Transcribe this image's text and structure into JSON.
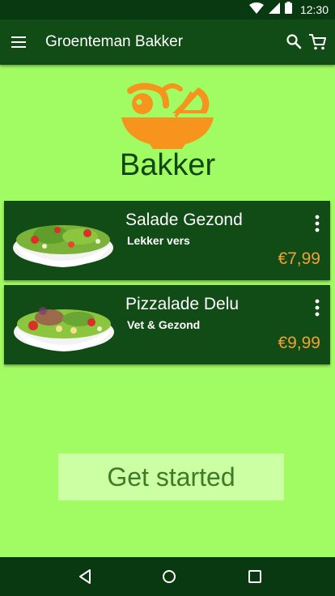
{
  "status_bar": {
    "time": "12:30"
  },
  "toolbar": {
    "title": "Groenteman Bakker"
  },
  "hero": {
    "title": "Bakker"
  },
  "products": [
    {
      "name": "Salade Gezond",
      "subtitle": "Lekker vers",
      "price": "€7,99"
    },
    {
      "name": "Pizzalade Delu",
      "subtitle": "Vet & Gezond",
      "price": "€9,99"
    }
  ],
  "cta": {
    "label": "Get started"
  },
  "colors": {
    "background": "#a1fb62",
    "toolbar": "#114b16",
    "status_bar": "#093910",
    "card": "#114b16",
    "price": "#f2a133",
    "logo": "#f7941d",
    "brand_text": "#124613",
    "cta_background": "#ccfea4",
    "cta_text": "#3f7a26"
  },
  "icons": {
    "status": [
      "wifi-icon",
      "signal-icon",
      "battery-icon"
    ],
    "toolbar": [
      "menu-icon",
      "search-icon",
      "cart-icon"
    ],
    "card": "more-vert-icon",
    "navigation": [
      "back-icon",
      "home-icon",
      "recents-icon"
    ]
  }
}
